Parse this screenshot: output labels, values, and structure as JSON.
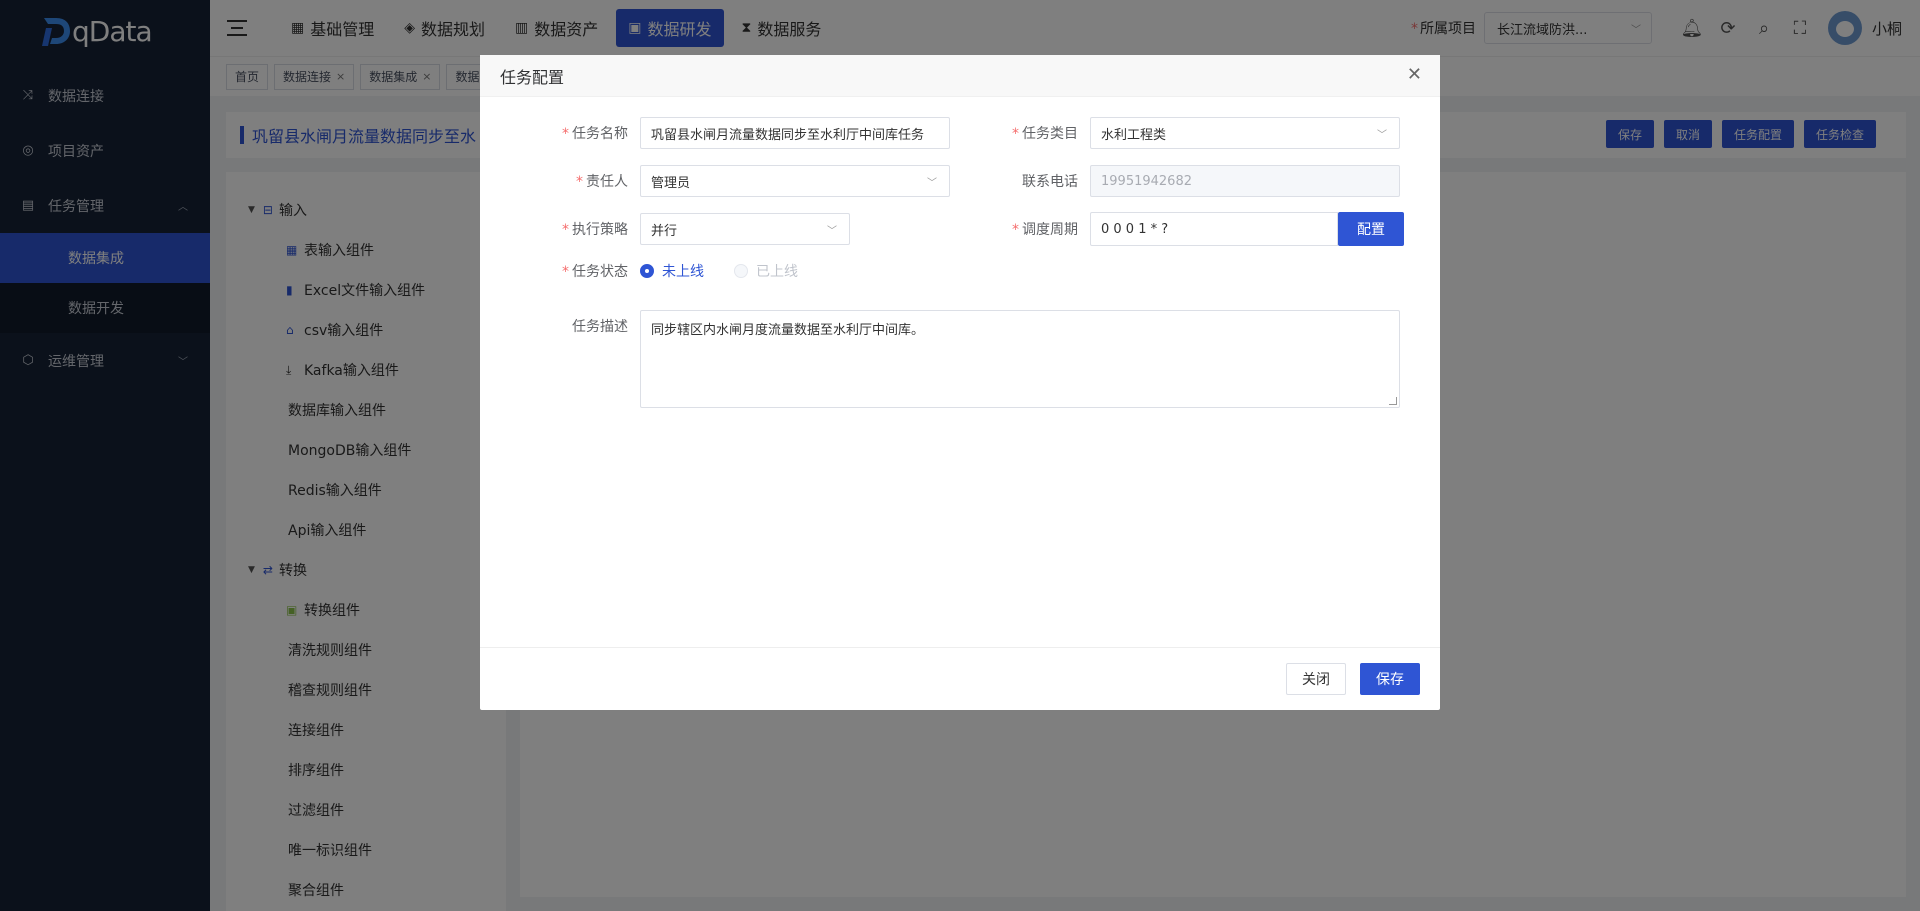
{
  "brand": {
    "logo_text": "qData"
  },
  "sidebar": {
    "items": [
      {
        "label": "数据连接",
        "icon": "shuffle-icon"
      },
      {
        "label": "项目资产",
        "icon": "asset-icon"
      },
      {
        "label": "任务管理",
        "icon": "document-icon",
        "expanded": true,
        "children": [
          {
            "label": "数据集成",
            "active": true
          },
          {
            "label": "数据开发"
          }
        ]
      },
      {
        "label": "运维管理",
        "icon": "cube-icon"
      }
    ]
  },
  "header": {
    "nav": [
      {
        "label": "基础管理"
      },
      {
        "label": "数据规划"
      },
      {
        "label": "数据资产"
      },
      {
        "label": "数据研发",
        "active": true
      },
      {
        "label": "数据服务"
      }
    ],
    "project_label": "所属项目",
    "project_value": "长江流域防洪...",
    "username": "小桐"
  },
  "tags": [
    {
      "label": "首页",
      "closable": false
    },
    {
      "label": "数据连接",
      "closable": true
    },
    {
      "label": "数据集成",
      "closable": true
    },
    {
      "label": "数据",
      "closable": false
    }
  ],
  "page": {
    "title": "巩留县水闸月流量数据同步至水",
    "actions": [
      "保存",
      "取消",
      "任务配置",
      "任务检查"
    ]
  },
  "tree": {
    "groups": [
      {
        "label": "输入",
        "items": [
          {
            "label": "表输入组件",
            "icon": "table-icon"
          },
          {
            "label": "Excel文件输入组件",
            "icon": "excel-icon"
          },
          {
            "label": "csv输入组件",
            "icon": "csv-icon"
          },
          {
            "label": "Kafka输入组件",
            "icon": "download-icon"
          },
          {
            "label": "数据库输入组件",
            "icon": ""
          },
          {
            "label": "MongoDB输入组件",
            "icon": ""
          },
          {
            "label": "Redis输入组件",
            "icon": ""
          },
          {
            "label": "Api输入组件",
            "icon": ""
          }
        ]
      },
      {
        "label": "转换",
        "items": [
          {
            "label": "转换组件",
            "icon": "transform-icon"
          },
          {
            "label": "清洗规则组件",
            "icon": ""
          },
          {
            "label": "稽查规则组件",
            "icon": ""
          },
          {
            "label": "连接组件",
            "icon": ""
          },
          {
            "label": "排序组件",
            "icon": ""
          },
          {
            "label": "过滤组件",
            "icon": ""
          },
          {
            "label": "唯一标识组件",
            "icon": ""
          },
          {
            "label": "聚合组件",
            "icon": ""
          }
        ]
      }
    ]
  },
  "dialog": {
    "title": "任务配置",
    "fields": {
      "task_name": {
        "label": "任务名称",
        "value": "巩留县水闸月流量数据同步至水利厅中间库任务"
      },
      "task_category": {
        "label": "任务类目",
        "value": "水利工程类"
      },
      "owner": {
        "label": "责任人",
        "value": "管理员"
      },
      "phone": {
        "label": "联系电话",
        "value": "19951942682"
      },
      "strategy": {
        "label": "执行策略",
        "value": "并行"
      },
      "schedule": {
        "label": "调度周期",
        "value": "0 0 0 1 * ?",
        "button": "配置"
      },
      "status": {
        "label": "任务状态",
        "options": [
          "未上线",
          "已上线"
        ],
        "selected": "未上线"
      },
      "description": {
        "label": "任务描述",
        "value": "同步辖区内水闸月度流量数据至水利厅中间库。"
      }
    },
    "footer": {
      "close": "关闭",
      "save": "保存"
    }
  },
  "colors": {
    "primary": "#2f55d4",
    "sidebar_bg": "#172337",
    "required": "#f56c6c"
  }
}
